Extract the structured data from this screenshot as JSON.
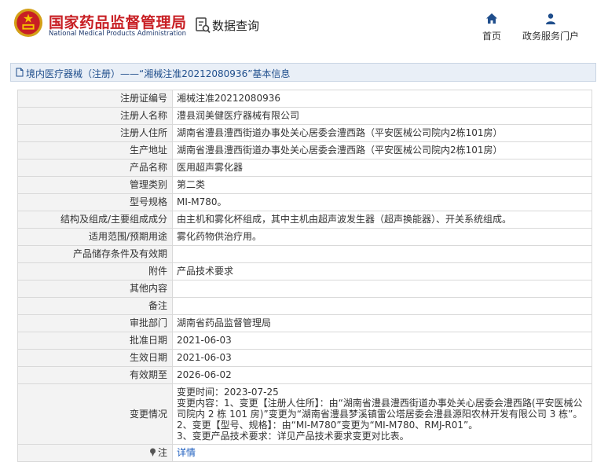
{
  "header": {
    "site_title": "国家药品监督管理局",
    "site_subtitle": "National Medical Products Administration",
    "query_label": "数据查询",
    "nav": {
      "home": "首页",
      "gov_portal": "政务服务门户"
    }
  },
  "breadcrumb": {
    "text": "境内医疗器械（注册）——“湘械注准20212080936”基本信息"
  },
  "record": {
    "rows": [
      {
        "label": "注册证编号",
        "value": "湘械注准20212080936"
      },
      {
        "label": "注册人名称",
        "value": "澧县润美健医疗器械有限公司"
      },
      {
        "label": "注册人住所",
        "value": "湖南省澧县澧西街道办事处关心居委会澧西路（平安医械公司院内2栋101房）"
      },
      {
        "label": "生产地址",
        "value": "湖南省澧县澧西街道办事处关心居委会澧西路（平安医械公司院内2栋101房）"
      },
      {
        "label": "产品名称",
        "value": "医用超声雾化器"
      },
      {
        "label": "管理类别",
        "value": "第二类"
      },
      {
        "label": "型号规格",
        "value": "MI-M780。"
      },
      {
        "label": "结构及组成/主要组成成分",
        "value": "由主机和雾化杯组成，其中主机由超声波发生器（超声换能器）、开关系统组成。"
      },
      {
        "label": "适用范围/预期用途",
        "value": "雾化药物供治疗用。"
      },
      {
        "label": "产品储存条件及有效期",
        "value": ""
      },
      {
        "label": "附件",
        "value": "产品技术要求"
      },
      {
        "label": "其他内容",
        "value": ""
      },
      {
        "label": "备注",
        "value": ""
      },
      {
        "label": "审批部门",
        "value": "湖南省药品监督管理局"
      },
      {
        "label": "批准日期",
        "value": "2021-06-03"
      },
      {
        "label": "生效日期",
        "value": "2021-06-03"
      },
      {
        "label": "有效期至",
        "value": "2026-06-02"
      }
    ],
    "change": {
      "label": "变更情况",
      "lines": [
        "变更时间：2023-07-25",
        "变更内容：1、变更【注册人住所】：由“湖南省澧县澧西街道办事处关心居委会澧西路(平安医械公司院内 2 栋 101 房)”变更为“湖南省澧县梦溪镇雷公塔居委会澧县源阳农林开发有限公司 3 栋”。",
        "2、变更【型号、规格】：由“MI-M780”变更为“MI-M780、RMJ-R01”。",
        "3、变更产品技术要求：详见产品技术要求变更对比表。"
      ]
    },
    "note": {
      "label": "注",
      "link_text": "详情"
    }
  },
  "colors": {
    "brand_red": "#c81f24",
    "brand_blue": "#1f3a6e",
    "crumb_bg": "#e9eff7",
    "label_bg": "#f3f3f3",
    "link": "#1f5fbf"
  },
  "icons": {
    "emblem": "national-emblem-icon",
    "query": "data-query-icon",
    "home": "home-icon",
    "gov": "user-icon",
    "crumb": "document-icon",
    "note": "pin-icon"
  }
}
